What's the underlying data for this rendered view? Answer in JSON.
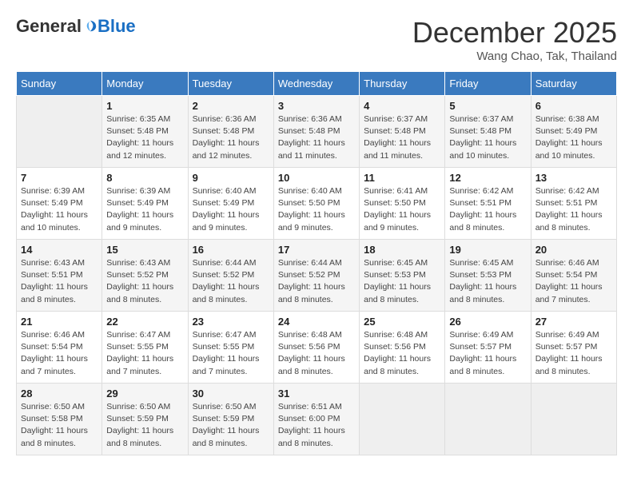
{
  "logo": {
    "general": "General",
    "blue": "Blue"
  },
  "title": "December 2025",
  "location": "Wang Chao, Tak, Thailand",
  "weekdays": [
    "Sunday",
    "Monday",
    "Tuesday",
    "Wednesday",
    "Thursday",
    "Friday",
    "Saturday"
  ],
  "weeks": [
    [
      {
        "day": "",
        "info": ""
      },
      {
        "day": "1",
        "info": "Sunrise: 6:35 AM\nSunset: 5:48 PM\nDaylight: 11 hours\nand 12 minutes."
      },
      {
        "day": "2",
        "info": "Sunrise: 6:36 AM\nSunset: 5:48 PM\nDaylight: 11 hours\nand 12 minutes."
      },
      {
        "day": "3",
        "info": "Sunrise: 6:36 AM\nSunset: 5:48 PM\nDaylight: 11 hours\nand 11 minutes."
      },
      {
        "day": "4",
        "info": "Sunrise: 6:37 AM\nSunset: 5:48 PM\nDaylight: 11 hours\nand 11 minutes."
      },
      {
        "day": "5",
        "info": "Sunrise: 6:37 AM\nSunset: 5:48 PM\nDaylight: 11 hours\nand 10 minutes."
      },
      {
        "day": "6",
        "info": "Sunrise: 6:38 AM\nSunset: 5:49 PM\nDaylight: 11 hours\nand 10 minutes."
      }
    ],
    [
      {
        "day": "7",
        "info": "Sunrise: 6:39 AM\nSunset: 5:49 PM\nDaylight: 11 hours\nand 10 minutes."
      },
      {
        "day": "8",
        "info": "Sunrise: 6:39 AM\nSunset: 5:49 PM\nDaylight: 11 hours\nand 9 minutes."
      },
      {
        "day": "9",
        "info": "Sunrise: 6:40 AM\nSunset: 5:49 PM\nDaylight: 11 hours\nand 9 minutes."
      },
      {
        "day": "10",
        "info": "Sunrise: 6:40 AM\nSunset: 5:50 PM\nDaylight: 11 hours\nand 9 minutes."
      },
      {
        "day": "11",
        "info": "Sunrise: 6:41 AM\nSunset: 5:50 PM\nDaylight: 11 hours\nand 9 minutes."
      },
      {
        "day": "12",
        "info": "Sunrise: 6:42 AM\nSunset: 5:51 PM\nDaylight: 11 hours\nand 8 minutes."
      },
      {
        "day": "13",
        "info": "Sunrise: 6:42 AM\nSunset: 5:51 PM\nDaylight: 11 hours\nand 8 minutes."
      }
    ],
    [
      {
        "day": "14",
        "info": "Sunrise: 6:43 AM\nSunset: 5:51 PM\nDaylight: 11 hours\nand 8 minutes."
      },
      {
        "day": "15",
        "info": "Sunrise: 6:43 AM\nSunset: 5:52 PM\nDaylight: 11 hours\nand 8 minutes."
      },
      {
        "day": "16",
        "info": "Sunrise: 6:44 AM\nSunset: 5:52 PM\nDaylight: 11 hours\nand 8 minutes."
      },
      {
        "day": "17",
        "info": "Sunrise: 6:44 AM\nSunset: 5:52 PM\nDaylight: 11 hours\nand 8 minutes."
      },
      {
        "day": "18",
        "info": "Sunrise: 6:45 AM\nSunset: 5:53 PM\nDaylight: 11 hours\nand 8 minutes."
      },
      {
        "day": "19",
        "info": "Sunrise: 6:45 AM\nSunset: 5:53 PM\nDaylight: 11 hours\nand 8 minutes."
      },
      {
        "day": "20",
        "info": "Sunrise: 6:46 AM\nSunset: 5:54 PM\nDaylight: 11 hours\nand 7 minutes."
      }
    ],
    [
      {
        "day": "21",
        "info": "Sunrise: 6:46 AM\nSunset: 5:54 PM\nDaylight: 11 hours\nand 7 minutes."
      },
      {
        "day": "22",
        "info": "Sunrise: 6:47 AM\nSunset: 5:55 PM\nDaylight: 11 hours\nand 7 minutes."
      },
      {
        "day": "23",
        "info": "Sunrise: 6:47 AM\nSunset: 5:55 PM\nDaylight: 11 hours\nand 7 minutes."
      },
      {
        "day": "24",
        "info": "Sunrise: 6:48 AM\nSunset: 5:56 PM\nDaylight: 11 hours\nand 8 minutes."
      },
      {
        "day": "25",
        "info": "Sunrise: 6:48 AM\nSunset: 5:56 PM\nDaylight: 11 hours\nand 8 minutes."
      },
      {
        "day": "26",
        "info": "Sunrise: 6:49 AM\nSunset: 5:57 PM\nDaylight: 11 hours\nand 8 minutes."
      },
      {
        "day": "27",
        "info": "Sunrise: 6:49 AM\nSunset: 5:57 PM\nDaylight: 11 hours\nand 8 minutes."
      }
    ],
    [
      {
        "day": "28",
        "info": "Sunrise: 6:50 AM\nSunset: 5:58 PM\nDaylight: 11 hours\nand 8 minutes."
      },
      {
        "day": "29",
        "info": "Sunrise: 6:50 AM\nSunset: 5:59 PM\nDaylight: 11 hours\nand 8 minutes."
      },
      {
        "day": "30",
        "info": "Sunrise: 6:50 AM\nSunset: 5:59 PM\nDaylight: 11 hours\nand 8 minutes."
      },
      {
        "day": "31",
        "info": "Sunrise: 6:51 AM\nSunset: 6:00 PM\nDaylight: 11 hours\nand 8 minutes."
      },
      {
        "day": "",
        "info": ""
      },
      {
        "day": "",
        "info": ""
      },
      {
        "day": "",
        "info": ""
      }
    ]
  ]
}
